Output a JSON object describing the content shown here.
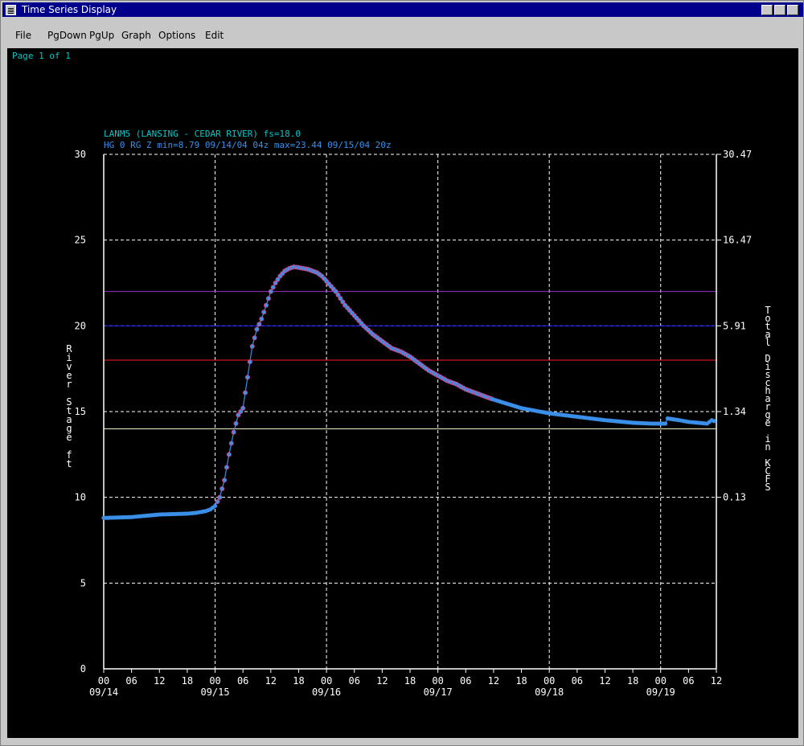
{
  "window": {
    "title": "Time Series Display"
  },
  "menu": [
    "File",
    "PgDown",
    "PgUp",
    "Graph",
    "Options",
    "Edit"
  ],
  "page_label": "Page 1 of 1",
  "chart_data": {
    "type": "line",
    "header_line1": "LANM5 (LANSING - CEDAR RIVER) fs=18.0",
    "header_line2": "HG 0 RG Z min=8.79 09/14/04 04z max=23.44 09/15/04 20z",
    "ylabel": "River Stage ft",
    "y2label": "Total Discharge in KCFS",
    "ylim": [
      0,
      30
    ],
    "yticks": [
      "0",
      "5",
      "10",
      "15",
      "20",
      "25",
      "30"
    ],
    "y2ticks": [
      "0.13",
      "1.34",
      "5.91",
      "16.47",
      "30.47"
    ],
    "x_hour_range": [
      0,
      132
    ],
    "xticks": [
      "00",
      "06",
      "12",
      "18",
      "00",
      "06",
      "12",
      "18",
      "00",
      "06",
      "12",
      "18",
      "00",
      "06",
      "12",
      "18",
      "00",
      "06",
      "12",
      "18",
      "00",
      "06",
      "12"
    ],
    "date_labels": [
      "09/14",
      "09/15",
      "09/16",
      "09/17",
      "09/18",
      "09/19"
    ],
    "reference_lines": [
      {
        "value": 22.0,
        "color": "#9933cc"
      },
      {
        "value": 20.0,
        "color": "#1a1aff"
      },
      {
        "value": 18.0,
        "color": "#ff2020"
      },
      {
        "value": 14.0,
        "color": "#ffffcc"
      }
    ],
    "series": [
      {
        "color": "#3a8fe8",
        "x": [
          0,
          6,
          12,
          18,
          20,
          22,
          23,
          24,
          25,
          26,
          27,
          28,
          29,
          30,
          31,
          32,
          33,
          34,
          35,
          36,
          37,
          38,
          39,
          40,
          41,
          42,
          43,
          44,
          45,
          46,
          47,
          48,
          49,
          50,
          51,
          52,
          54,
          56,
          58,
          60,
          62,
          64,
          66,
          68,
          70,
          72,
          74,
          76,
          78,
          80,
          84,
          90,
          96,
          102,
          108,
          114,
          118,
          121,
          121.5,
          124,
          126,
          128,
          130,
          131,
          132
        ],
        "y": [
          8.8,
          8.85,
          9.0,
          9.05,
          9.1,
          9.2,
          9.3,
          9.5,
          10.0,
          11.0,
          12.5,
          13.8,
          14.8,
          15.2,
          17.0,
          18.8,
          19.8,
          20.4,
          21.2,
          22.0,
          22.5,
          22.9,
          23.2,
          23.35,
          23.44,
          23.4,
          23.35,
          23.3,
          23.2,
          23.1,
          22.9,
          22.6,
          22.3,
          22.0,
          21.6,
          21.2,
          20.6,
          20.0,
          19.5,
          19.1,
          18.7,
          18.5,
          18.2,
          17.8,
          17.4,
          17.1,
          16.8,
          16.6,
          16.3,
          16.1,
          15.7,
          15.2,
          14.9,
          14.7,
          14.5,
          14.35,
          14.3,
          14.3,
          14.6,
          14.5,
          14.4,
          14.35,
          14.3,
          14.5,
          14.4
        ]
      }
    ],
    "grid": "dashed"
  }
}
